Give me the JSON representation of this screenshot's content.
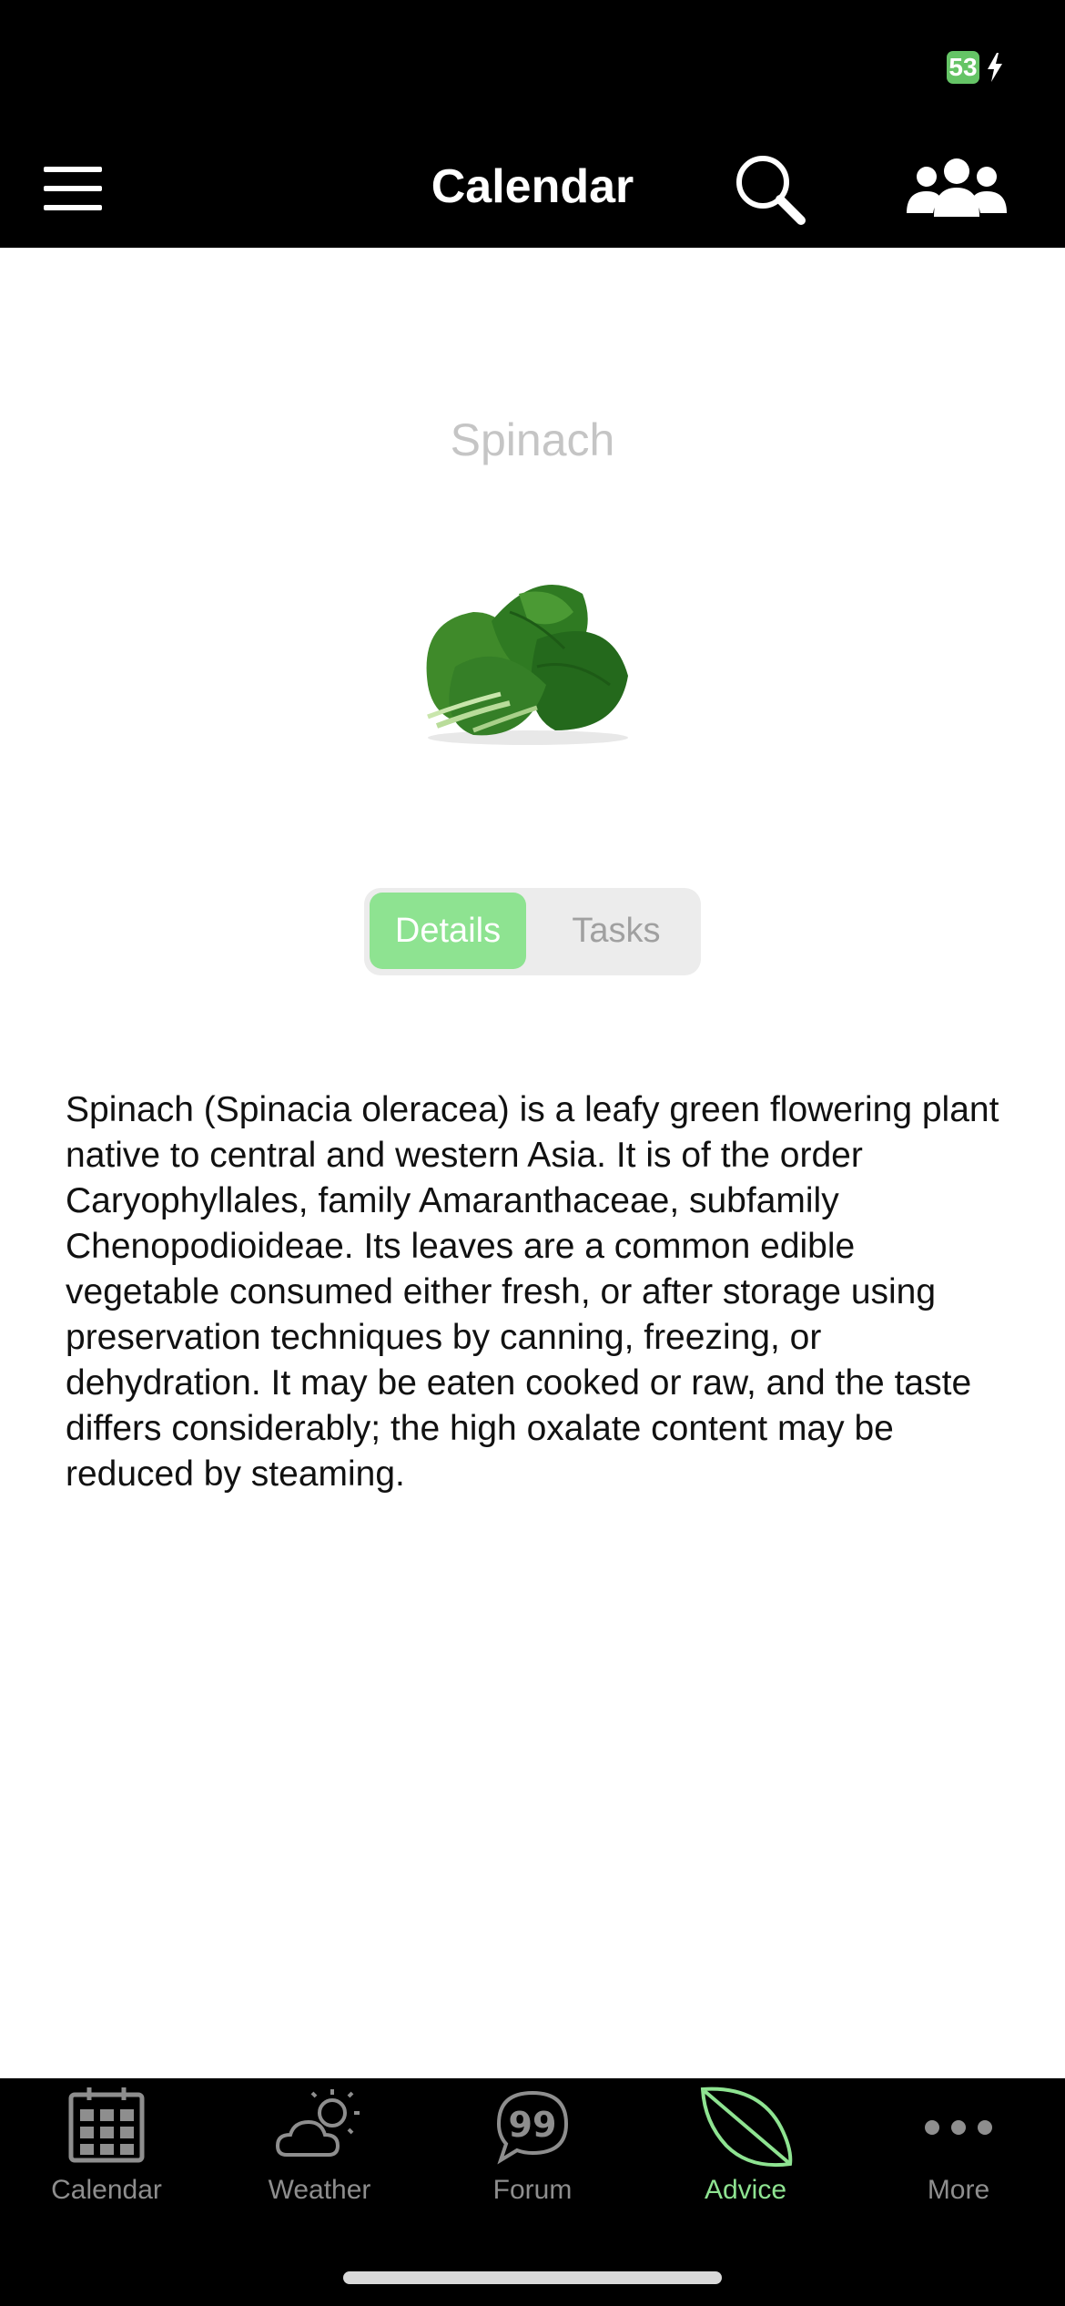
{
  "status_bar": {
    "battery_level": "53"
  },
  "header": {
    "title": "Calendar"
  },
  "plant": {
    "name": "Spinach",
    "description": "Spinach (Spinacia oleracea) is a leafy green flowering plant native to central and western Asia. It is of the order Caryophyllales, family Amaranthaceae, subfamily Chenopodioideae. Its leaves are a common edible vegetable consumed either fresh, or after storage using preservation techniques by canning, freezing, or dehydration. It may be eaten cooked or raw, and the taste differs considerably; the high oxalate content may be reduced by steaming."
  },
  "segments": {
    "details_label": "Details",
    "tasks_label": "Tasks",
    "selected": "Details"
  },
  "tab_bar": {
    "items": [
      {
        "label": "Calendar",
        "icon": "calendar-grid-icon"
      },
      {
        "label": "Weather",
        "icon": "cloud-sun-icon"
      },
      {
        "label": "Forum",
        "icon": "speech-bubble-icon"
      },
      {
        "label": "Advice",
        "icon": "leaf-icon"
      },
      {
        "label": "More",
        "icon": "ellipsis-icon"
      }
    ],
    "active": "Advice"
  },
  "colors": {
    "accent": "#8ee391",
    "battery": "#65c466",
    "bar_background": "#000000",
    "inactive": "#8e8e8e"
  }
}
